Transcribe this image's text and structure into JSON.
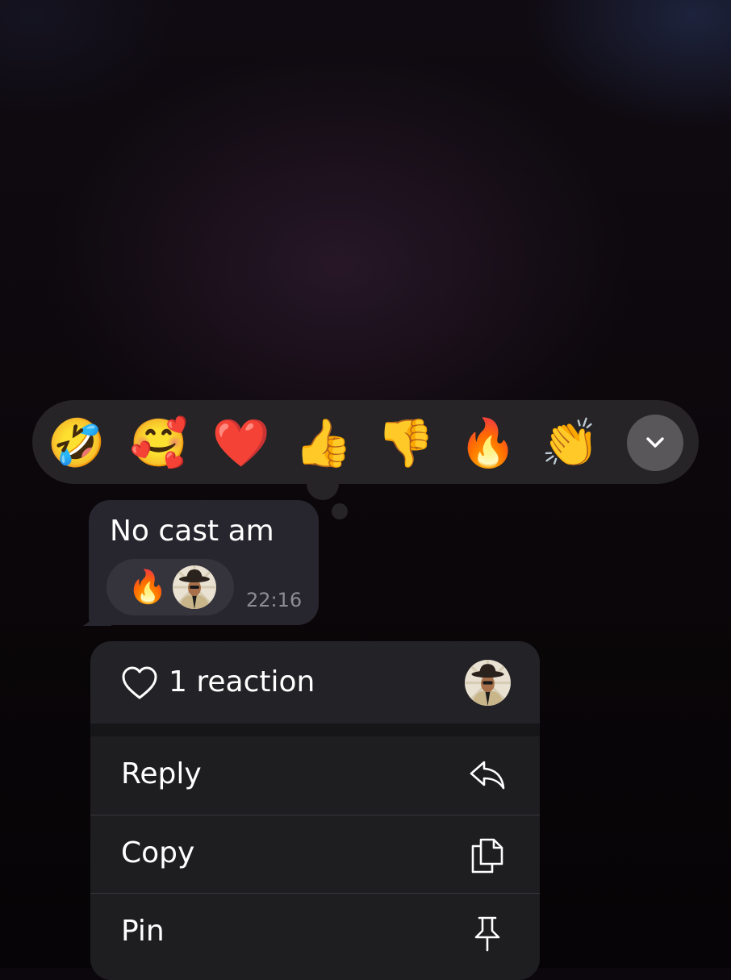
{
  "reaction_picker": {
    "emojis": [
      "🤣",
      "🥰",
      "❤️",
      "👍",
      "👎",
      "🔥",
      "👏"
    ]
  },
  "message": {
    "text": "No cast am",
    "reaction_emoji": "🔥",
    "time": "22:16"
  },
  "context_menu": {
    "reactions_label": "1 reaction",
    "items": [
      {
        "label": "Reply",
        "icon": "reply-icon"
      },
      {
        "label": "Copy",
        "icon": "copy-icon"
      },
      {
        "label": "Pin",
        "icon": "pin-icon"
      }
    ]
  },
  "colors": {
    "picker_bg": "#262427",
    "bubble_bg": "#27252d",
    "menu_bg": "#1e1d20",
    "time_text": "#8e8b95"
  }
}
